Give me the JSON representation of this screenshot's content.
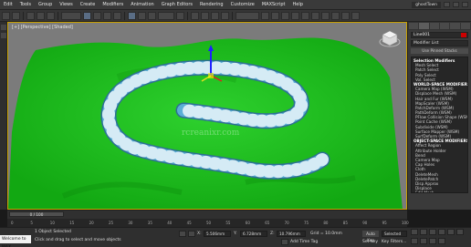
{
  "menubar": {
    "items": [
      "Edit",
      "Tools",
      "Group",
      "Views",
      "Create",
      "Modifiers",
      "Animation",
      "Graph Editors",
      "Rendering",
      "Customize",
      "MAXScript",
      "Help"
    ],
    "workspace": "ghostTown"
  },
  "viewport": {
    "label_parts": [
      "[+]",
      "[Perspective]",
      "[Shaded]"
    ],
    "watermark": "rcreanixr.com",
    "terrain_color": "#1fbf1f",
    "road_color": "#4f9dc7"
  },
  "command_panel": {
    "object_name": "Line001",
    "object_color": "#c80000",
    "modifier_list": "Modifier List",
    "use_pinned": "Use Pinned Stacks",
    "list": [
      {
        "text": "Selection Modifiers",
        "header": true
      },
      {
        "text": "Mesh Select"
      },
      {
        "text": "Patch Select"
      },
      {
        "text": "Poly Select"
      },
      {
        "text": "Vol. Select"
      },
      {
        "text": "WORLD-SPACE MODIFIERS",
        "header": true
      },
      {
        "text": "Camera Map (WSM)"
      },
      {
        "text": "Displace Mesh (WSM)"
      },
      {
        "text": "Hair and Fur (WSM)"
      },
      {
        "text": "MapScaler (WSM)"
      },
      {
        "text": "PatchDeform (WSM)"
      },
      {
        "text": "PathDeform (WSM)"
      },
      {
        "text": "PFlow Collision Shape (WSM)"
      },
      {
        "text": "Point Cache (WSM)"
      },
      {
        "text": "Subdivide (WSM)"
      },
      {
        "text": "Surface Mapper (WSM)"
      },
      {
        "text": "SurfDeform (WSM)"
      },
      {
        "text": "OBJECT-SPACE MODIFIERS",
        "header": true
      },
      {
        "text": "Affect Region"
      },
      {
        "text": "Attribute Holder"
      },
      {
        "text": "Bend"
      },
      {
        "text": "Camera Map"
      },
      {
        "text": "Cap Holes"
      },
      {
        "text": "Cloth"
      },
      {
        "text": "DeleteMesh"
      },
      {
        "text": "DeletePatch"
      },
      {
        "text": "Disp Approx"
      },
      {
        "text": "Displace"
      },
      {
        "text": "Edit Mesh"
      },
      {
        "text": "Edit Normals"
      },
      {
        "text": "Edit Patch"
      },
      {
        "text": "Edit Poly"
      }
    ]
  },
  "timeline": {
    "slider": "0 / 100",
    "ticks": [
      "0",
      "5",
      "10",
      "15",
      "20",
      "25",
      "30",
      "35",
      "40",
      "45",
      "50",
      "55",
      "60",
      "65",
      "70",
      "75",
      "80",
      "85",
      "90",
      "95",
      "100"
    ]
  },
  "status": {
    "maxscript": "Welcome to MAX",
    "selected": "1 Object Selected",
    "prompt": "Click and drag to select and move objects",
    "x_label": "X:",
    "x_value": "5.506mm",
    "y_label": "Y:",
    "y_value": "6.728mm",
    "z_label": "Z:",
    "z_value": "10.796mm",
    "grid": "Grid = 10.0mm",
    "add_time_tag": "Add Time Tag",
    "auto_key": "Auto Key",
    "selected_dropdown": "Selected",
    "set_key": "Set Key",
    "key_filters": "Key Filters..."
  }
}
